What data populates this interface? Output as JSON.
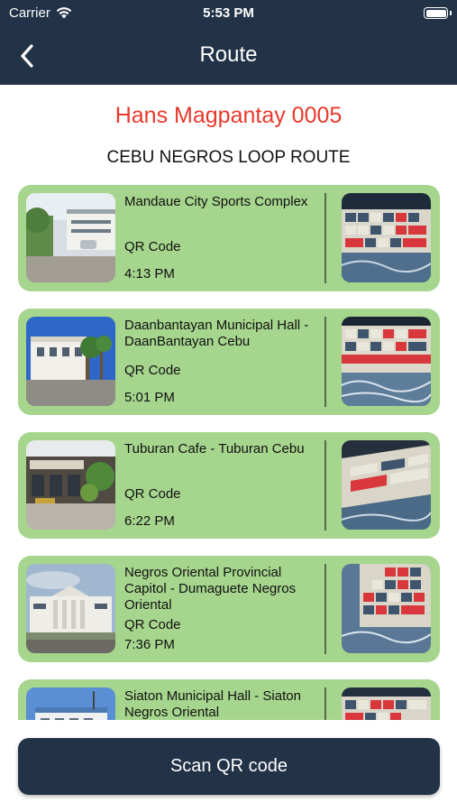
{
  "status_bar": {
    "carrier": "Carrier",
    "time": "5:53 PM"
  },
  "nav": {
    "title": "Route",
    "back_icon": "chevron-left-icon"
  },
  "user_name": "Hans Magpantay 0005",
  "route_name": "CEBU NEGROS LOOP ROUTE",
  "stops": [
    {
      "title": "Mandaue City Sports Complex",
      "qr_label": "QR Code",
      "time": "4:13 PM",
      "photo": "sports-complex-photo",
      "qr_photo": "keyboard-photo"
    },
    {
      "title": "Daanbantayan Municipal Hall - DaanBantayan Cebu",
      "qr_label": "QR Code",
      "time": "5:01 PM",
      "photo": "municipal-hall-photo",
      "qr_photo": "keyboard-photo"
    },
    {
      "title": "Tuburan Cafe - Tuburan Cebu",
      "qr_label": "QR Code",
      "time": "6:22 PM",
      "photo": "cafe-photo",
      "qr_photo": "keyboard-photo"
    },
    {
      "title": "Negros Oriental Provincial Capitol - Dumaguete Negros Oriental",
      "qr_label": "QR Code",
      "time": "7:36 PM",
      "photo": "capitol-photo",
      "qr_photo": "keyboard-photo"
    },
    {
      "title": "Siaton Municipal Hall - Siaton Negros Oriental",
      "qr_label": "",
      "time": "",
      "photo": "municipal-hall-photo",
      "qr_photo": "keyboard-photo"
    }
  ],
  "scan_button": {
    "label": "Scan QR code"
  },
  "colors": {
    "header": "#223247",
    "card": "#a6d58d",
    "user_name": "#e8392c"
  }
}
